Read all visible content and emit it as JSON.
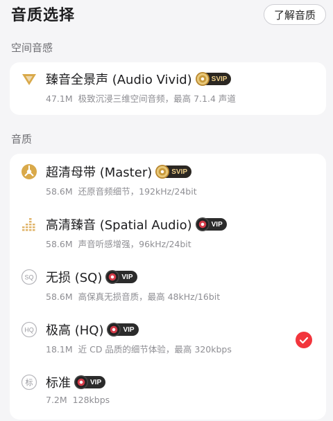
{
  "header": {
    "title": "音质选择",
    "learn_button": "了解音质"
  },
  "sections": {
    "spatial_label": "空间音感",
    "quality_label": "音质"
  },
  "spatial_item": {
    "title": "臻音全景声 (Audio Vivid)",
    "badge": "SVIP",
    "size": "47.1M",
    "desc": "极致沉浸三维空间音频，最高 7.1.4 声道",
    "icon": "vivid-triangle-icon"
  },
  "quality_items": [
    {
      "title": "超清母带 (Master)",
      "badge": "SVIP",
      "size": "58.6M",
      "desc": "还原音频细节，192kHz/24bit",
      "icon": "master-disc-icon",
      "selected": false
    },
    {
      "title": "高清臻音 (Spatial Audio)",
      "badge": "VIP",
      "size": "58.6M",
      "desc": "声音听感增强，96kHz/24bit",
      "icon": "equalizer-bars-icon",
      "selected": false
    },
    {
      "title": "无损 (SQ)",
      "badge": "VIP",
      "size": "58.6M",
      "desc": "高保真无损音质，最高 48kHz/16bit",
      "icon": "sq-circle-icon",
      "icon_text": "SQ",
      "selected": false
    },
    {
      "title": "极高 (HQ)",
      "badge": "VIP",
      "size": "18.1M",
      "desc": "近 CD 品质的细节体验，最高 320kbps",
      "icon": "hq-circle-icon",
      "icon_text": "HQ",
      "selected": true
    },
    {
      "title": "标准",
      "badge": "VIP",
      "size": "7.2M",
      "desc": "128kbps",
      "icon": "standard-circle-icon",
      "icon_text": "标",
      "selected": false
    }
  ],
  "colors": {
    "accent_red": "#f2353c",
    "gold": "#d9a94a",
    "secondary_text": "#8e8e93"
  }
}
